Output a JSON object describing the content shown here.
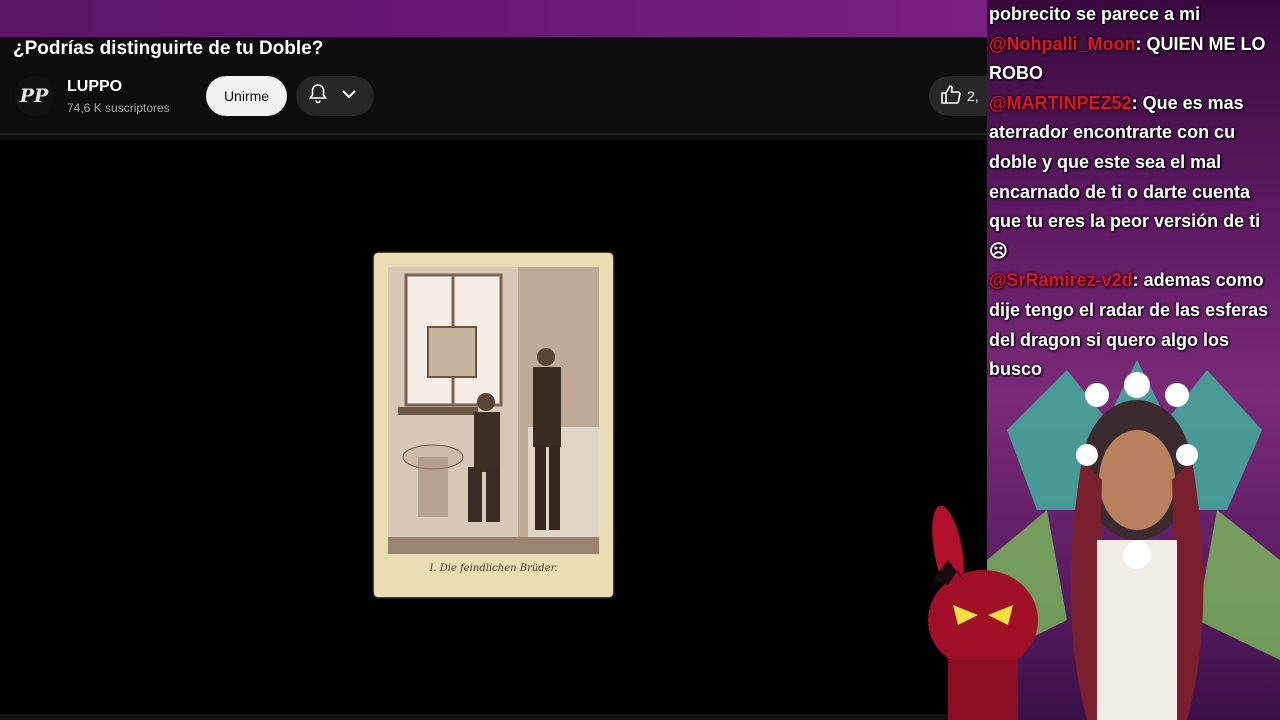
{
  "video": {
    "title": "¿Podrías distinguirte de tu Doble?",
    "photo_caption": "I. Die feindlichen Brüder."
  },
  "channel": {
    "avatar_text": "PP",
    "name": "LUPPO",
    "subscribers": "74,6 K suscriptores",
    "join_label": "Unirme",
    "like_count": "2,"
  },
  "icons": {
    "bell": "bell-icon",
    "chevron": "chevron-down-icon",
    "like": "thumbs-up-icon"
  },
  "chat": {
    "messages": [
      {
        "user": "",
        "text": "pobrecito se parece a mi"
      },
      {
        "user": "@Nohpalli_Moon",
        "text": ": QUIEN ME LO ROBO"
      },
      {
        "user": "@MARTINPEZ52",
        "text": ": Que es mas aterrador encontrarte con cu doble y que este sea el mal encarnado de ti o darte cuenta que tu eres la peor versión de ti"
      },
      {
        "user": "@SrRamirez-v2d",
        "text": ": ademas como dije tengo el radar de las esferas del dragon si quero algo los busco"
      }
    ]
  },
  "colors": {
    "accent_bar": "#6b1a78",
    "chat_user": "#e8102b",
    "join_bg": "#f1f1f1"
  }
}
